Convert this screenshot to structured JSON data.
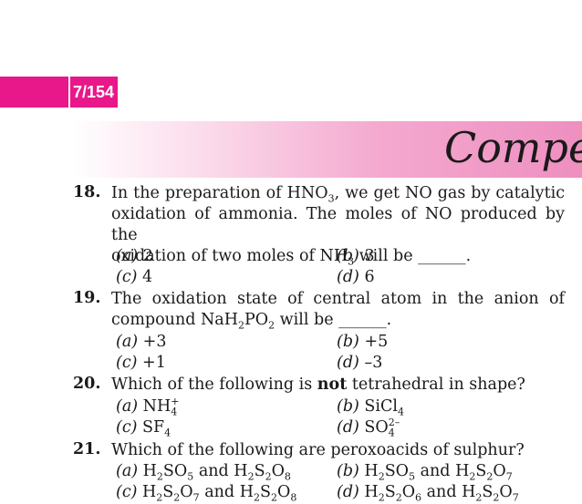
{
  "page_label": "7/154",
  "banner_title": "Competi",
  "questions": [
    {
      "num": "18.",
      "options": [
        {
          "label": "(a)",
          "value": "2"
        },
        {
          "label": "(b)",
          "value": "3"
        },
        {
          "label": "(c)",
          "value": "4"
        },
        {
          "label": "(d)",
          "value": "6"
        }
      ]
    },
    {
      "num": "19.",
      "options": [
        {
          "label": "(a)",
          "value": "+3"
        },
        {
          "label": "(b)",
          "value": "+5"
        },
        {
          "label": "(c)",
          "value": "+1"
        },
        {
          "label": "(d)",
          "value": "–3"
        }
      ]
    },
    {
      "num": "20.",
      "text_pre": "Which of the following is ",
      "text_bold": "not",
      "text_post": " tetrahedral in shape?"
    },
    {
      "num": "21.",
      "text": "Which of the following are peroxoacids of sulphur?"
    }
  ]
}
